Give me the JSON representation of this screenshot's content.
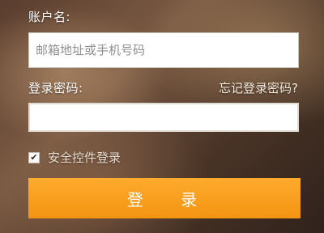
{
  "form": {
    "account_label": "账户名:",
    "account_placeholder": "邮箱地址或手机号码",
    "account_value": "",
    "password_label": "登录密码:",
    "forgot_link": "忘记登录密码?",
    "password_value": "",
    "security_control_label": "安全控件登录",
    "security_control_checked": true,
    "login_button": "登 录"
  },
  "colors": {
    "button_orange": "#f7a01e",
    "label_text": "#ffffff"
  }
}
